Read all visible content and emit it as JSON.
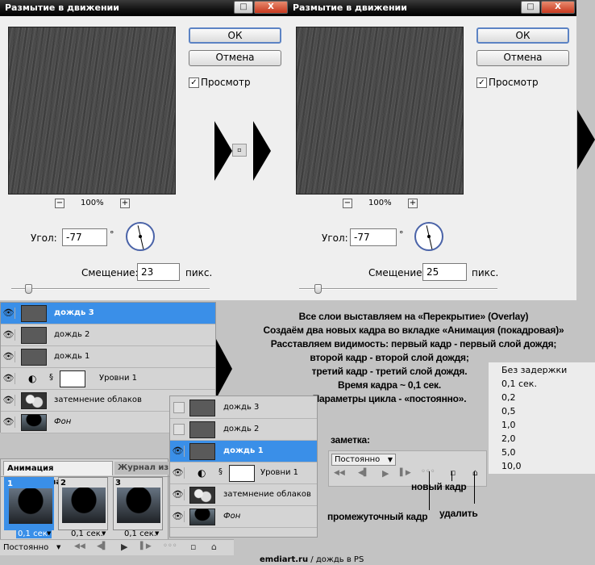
{
  "dialog1": {
    "title": "Размытие в движении",
    "ok": "ОК",
    "cancel": "Отмена",
    "preview_label": "Просмотр",
    "preview_checked": "✓",
    "zoom": "100%",
    "zoom_minus": "−",
    "zoom_plus": "+",
    "angle_label": "Угол:",
    "angle_value": "-77",
    "degree": "°",
    "offset_label": "Смещение:",
    "offset_value": "23",
    "offset_unit": "пикс."
  },
  "dialog2": {
    "title": "Размытие в движении",
    "ok": "ОК",
    "cancel": "Отмена",
    "preview_label": "Просмотр",
    "preview_checked": "✓",
    "zoom": "100%",
    "zoom_minus": "−",
    "zoom_plus": "+",
    "angle_label": "Угол:",
    "angle_value": "-77",
    "degree": "°",
    "offset_label": "Смещение:",
    "offset_value": "25",
    "offset_unit": "пикс."
  },
  "window_buttons": {
    "minimize": "_",
    "maximize": "□",
    "close": "X"
  },
  "layers_main": [
    {
      "name": "дождь 3",
      "selected": true,
      "thumb": "gray"
    },
    {
      "name": "дождь 2",
      "thumb": "gray"
    },
    {
      "name": "дождь 1",
      "thumb": "gray"
    },
    {
      "name": "Уровни 1",
      "thumb": "white"
    },
    {
      "name": "затемнение облаков",
      "thumb": "clouds"
    },
    {
      "name": "Фон",
      "thumb": "photo"
    }
  ],
  "layers_small": [
    {
      "name": "дождь 3",
      "visible": false
    },
    {
      "name": "дождь 2",
      "visible": false
    },
    {
      "name": "дождь 1",
      "visible": true,
      "selected": true
    },
    {
      "name": "Уровни 1",
      "visible": true
    },
    {
      "name": "затемнение облаков",
      "visible": true
    },
    {
      "name": "Фон",
      "visible": true
    }
  ],
  "instructions": [
    "Все слои выставляем на «Перекрытие» (Overlay)",
    "Создаём два новых кадра во вкладке «Анимация (покадровая)»",
    "Расставляем видимость: первый кадр - первый слой дождя;",
    "второй кадр - второй слой дождя;",
    "третий кадр - третий слой дождя.",
    "Время кадра ~ 0,1 сек.",
    "Параметры цикла - «постоянно»."
  ],
  "delay_options": [
    "Без задержки",
    "0,1 сек.",
    "0,2",
    "0,5",
    "1,0",
    "2,0",
    "5,0",
    "10,0"
  ],
  "note": {
    "title": "заметка:",
    "loop": "Постоянно",
    "new_frame": "новый кадр",
    "delete": "удалить",
    "tween": "промежуточный кадр"
  },
  "animation": {
    "tab_active": "Анимация (покадровая)",
    "tab_inactive": "Журнал изм",
    "frames": [
      {
        "num": "1",
        "delay": "0,1 сек."
      },
      {
        "num": "2",
        "delay": "0,1 сек."
      },
      {
        "num": "3",
        "delay": "0,1 сек."
      }
    ],
    "loop": "Постоянно"
  },
  "footer": {
    "site": "emdiart.ru",
    "caption": " / дождь в PS"
  },
  "icons": {
    "eye": "👁",
    "chain": "🔗",
    "adjust": "◐",
    "dropdown": "▼",
    "first": "◀◀",
    "prev": "◀▌",
    "play": "▶",
    "next": "▌▶",
    "tween": "◦◦◦",
    "newframe": "▫",
    "trash": "🗑"
  }
}
